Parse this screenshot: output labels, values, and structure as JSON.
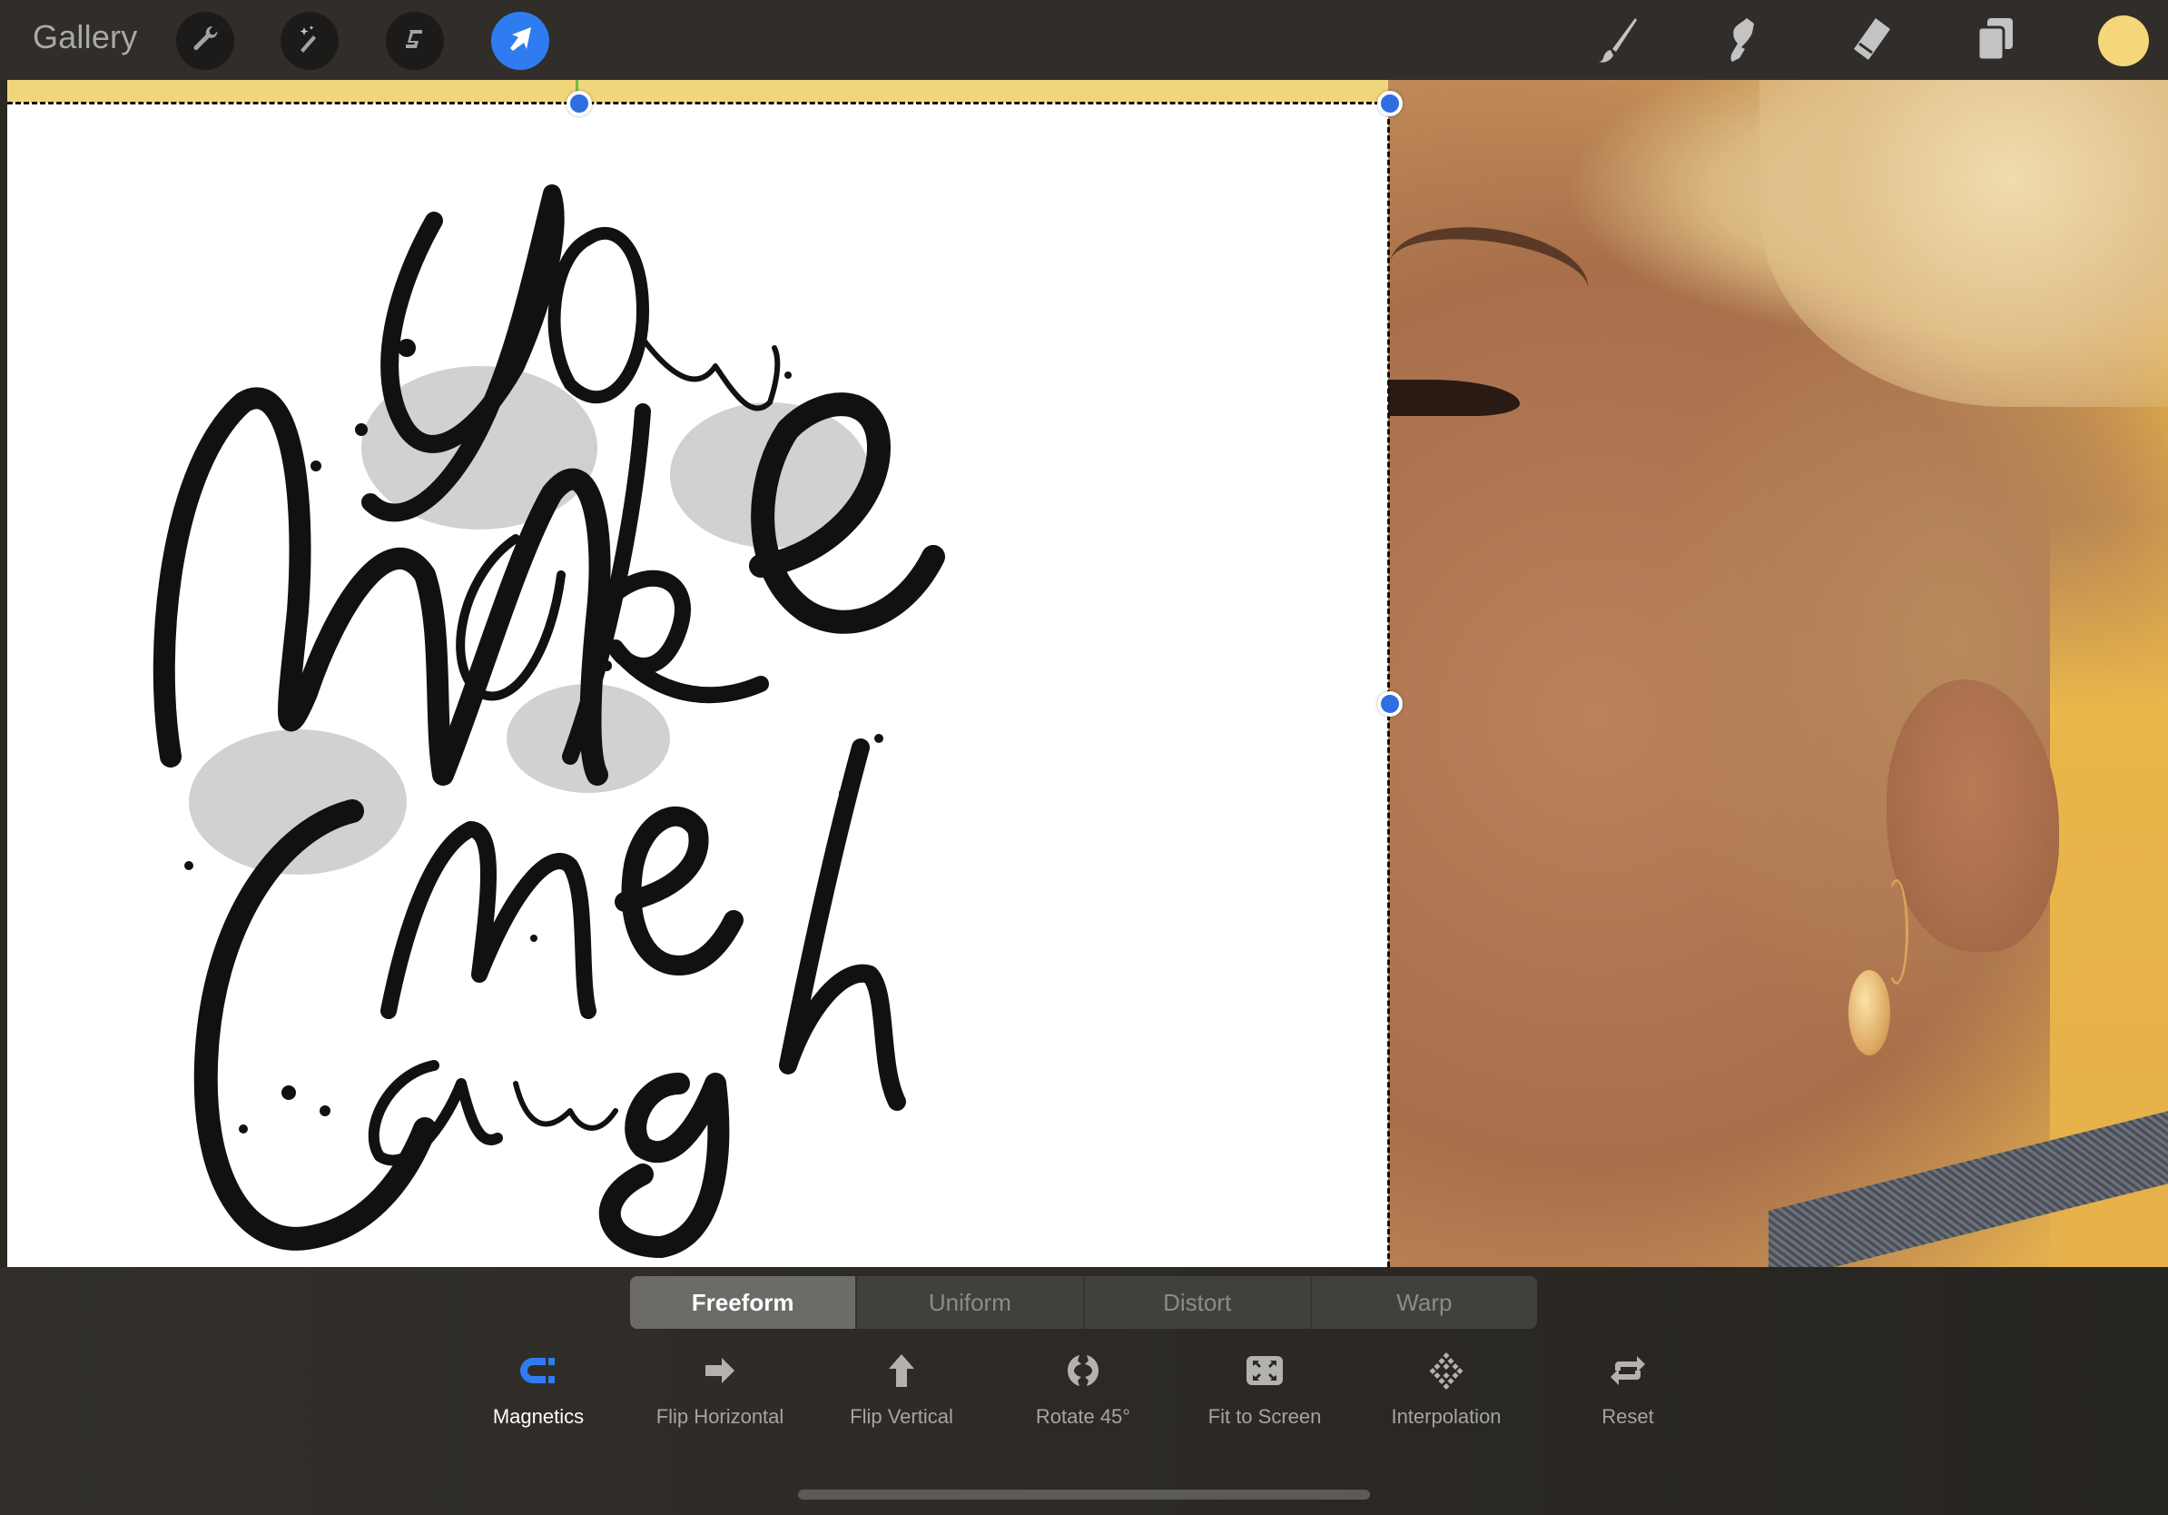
{
  "topbar": {
    "gallery_label": "Gallery",
    "left_tools": [
      {
        "name": "actions",
        "icon": "wrench-icon",
        "active": false
      },
      {
        "name": "adjustments",
        "icon": "magic-wand-icon",
        "active": false
      },
      {
        "name": "selection",
        "icon": "selection-s-icon",
        "active": false
      },
      {
        "name": "transform",
        "icon": "arrow-cursor-icon",
        "active": true
      }
    ],
    "right_tools": [
      {
        "name": "brush",
        "icon": "paintbrush-icon"
      },
      {
        "name": "smudge",
        "icon": "smudge-finger-icon"
      },
      {
        "name": "eraser",
        "icon": "eraser-icon"
      },
      {
        "name": "layers",
        "icon": "layers-icon"
      }
    ],
    "current_color": "#f5d67a",
    "accent_color": "#2f7cf0"
  },
  "canvas": {
    "artwork_text": "You make me laugh",
    "artwork_style": "black brush hand-lettering on white layer",
    "background_photo": "close-up portrait with blonde hair and gold earring on yellow background",
    "selection_mode": "transform"
  },
  "transform_modes": {
    "items": [
      {
        "label": "Freeform",
        "active": true
      },
      {
        "label": "Uniform",
        "active": false
      },
      {
        "label": "Distort",
        "active": false
      },
      {
        "label": "Warp",
        "active": false
      }
    ]
  },
  "transform_tools": {
    "items": [
      {
        "label": "Magnetics",
        "icon": "magnet-icon",
        "active": true
      },
      {
        "label": "Flip Horizontal",
        "icon": "arrow-right-icon",
        "active": false
      },
      {
        "label": "Flip Vertical",
        "icon": "arrow-up-icon",
        "active": false
      },
      {
        "label": "Rotate 45°",
        "icon": "rotate-icon",
        "active": false
      },
      {
        "label": "Fit to Screen",
        "icon": "fit-to-screen-icon",
        "active": false
      },
      {
        "label": "Interpolation",
        "icon": "interpolation-icon",
        "active": false
      },
      {
        "label": "Reset",
        "icon": "reset-icon",
        "active": false
      }
    ]
  }
}
